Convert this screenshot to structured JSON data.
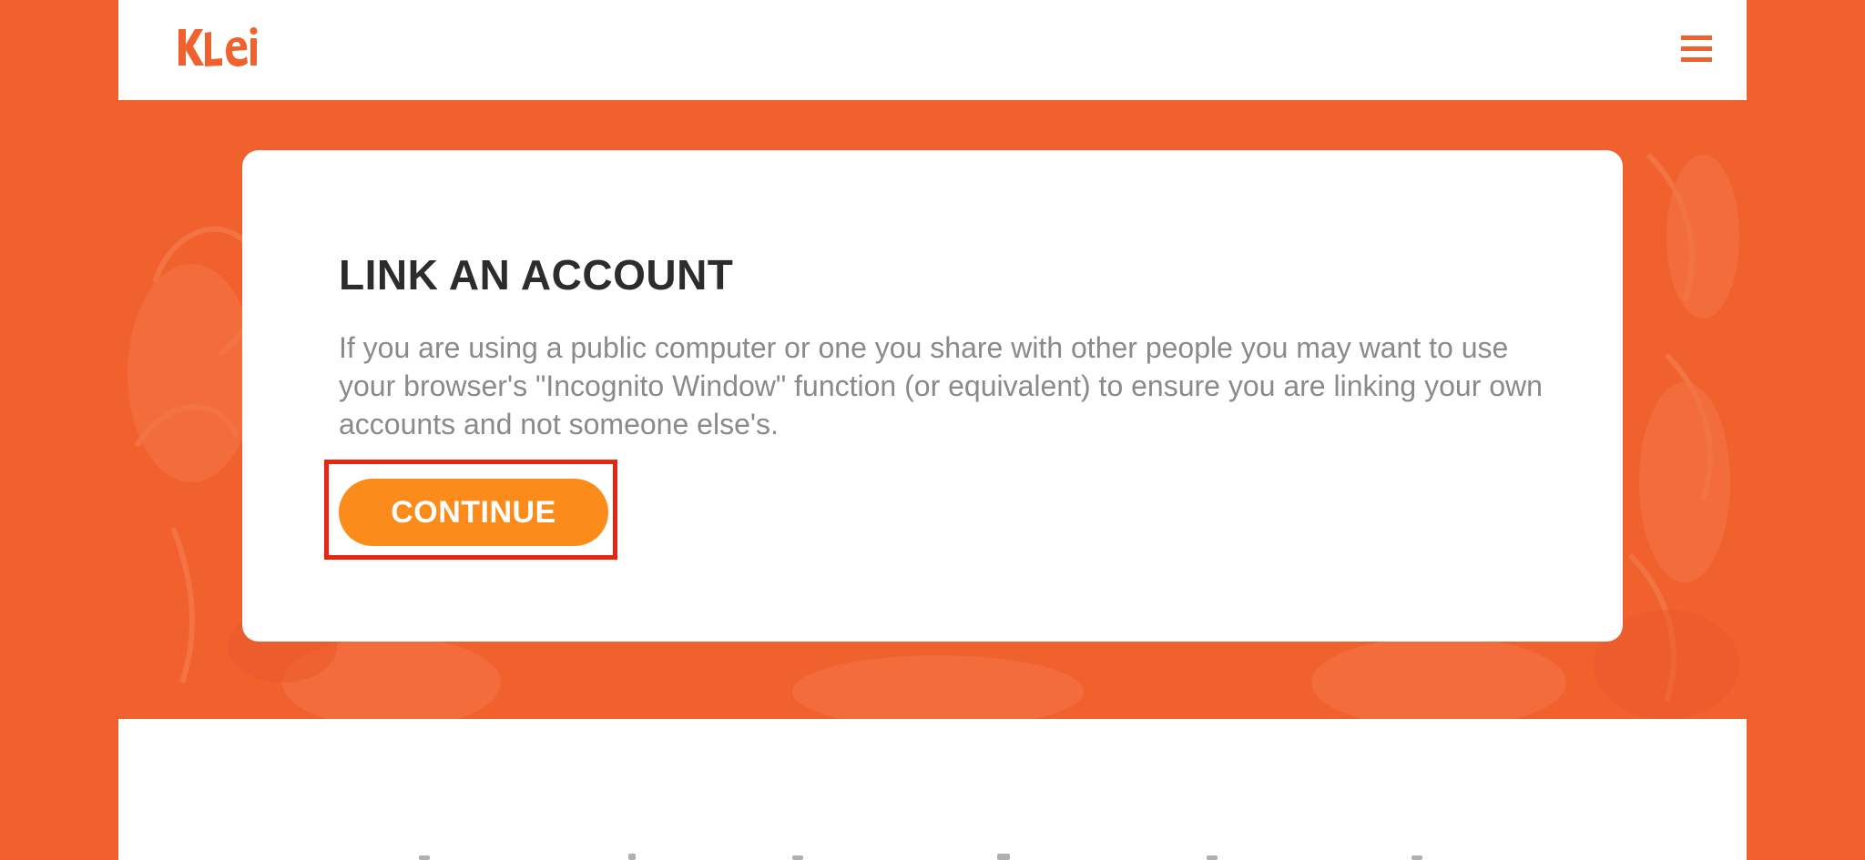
{
  "header": {
    "logo_text": "KLei",
    "menu_icon": "hamburger-menu-icon"
  },
  "dialog": {
    "title": "LINK AN ACCOUNT",
    "message": "If you are using a public computer or one you share with other people you may want to use your browser's \"Incognito Window\" function (or equivalent) to ensure you are linking your own accounts and not someone else's.",
    "continue_label": "CONTINUE"
  },
  "colors": {
    "brand_orange": "#f0612e",
    "button_orange": "#fb8c1b",
    "highlight_red": "#e8250f",
    "title_text": "#2c2c2c",
    "body_text": "#8a8a8a"
  }
}
